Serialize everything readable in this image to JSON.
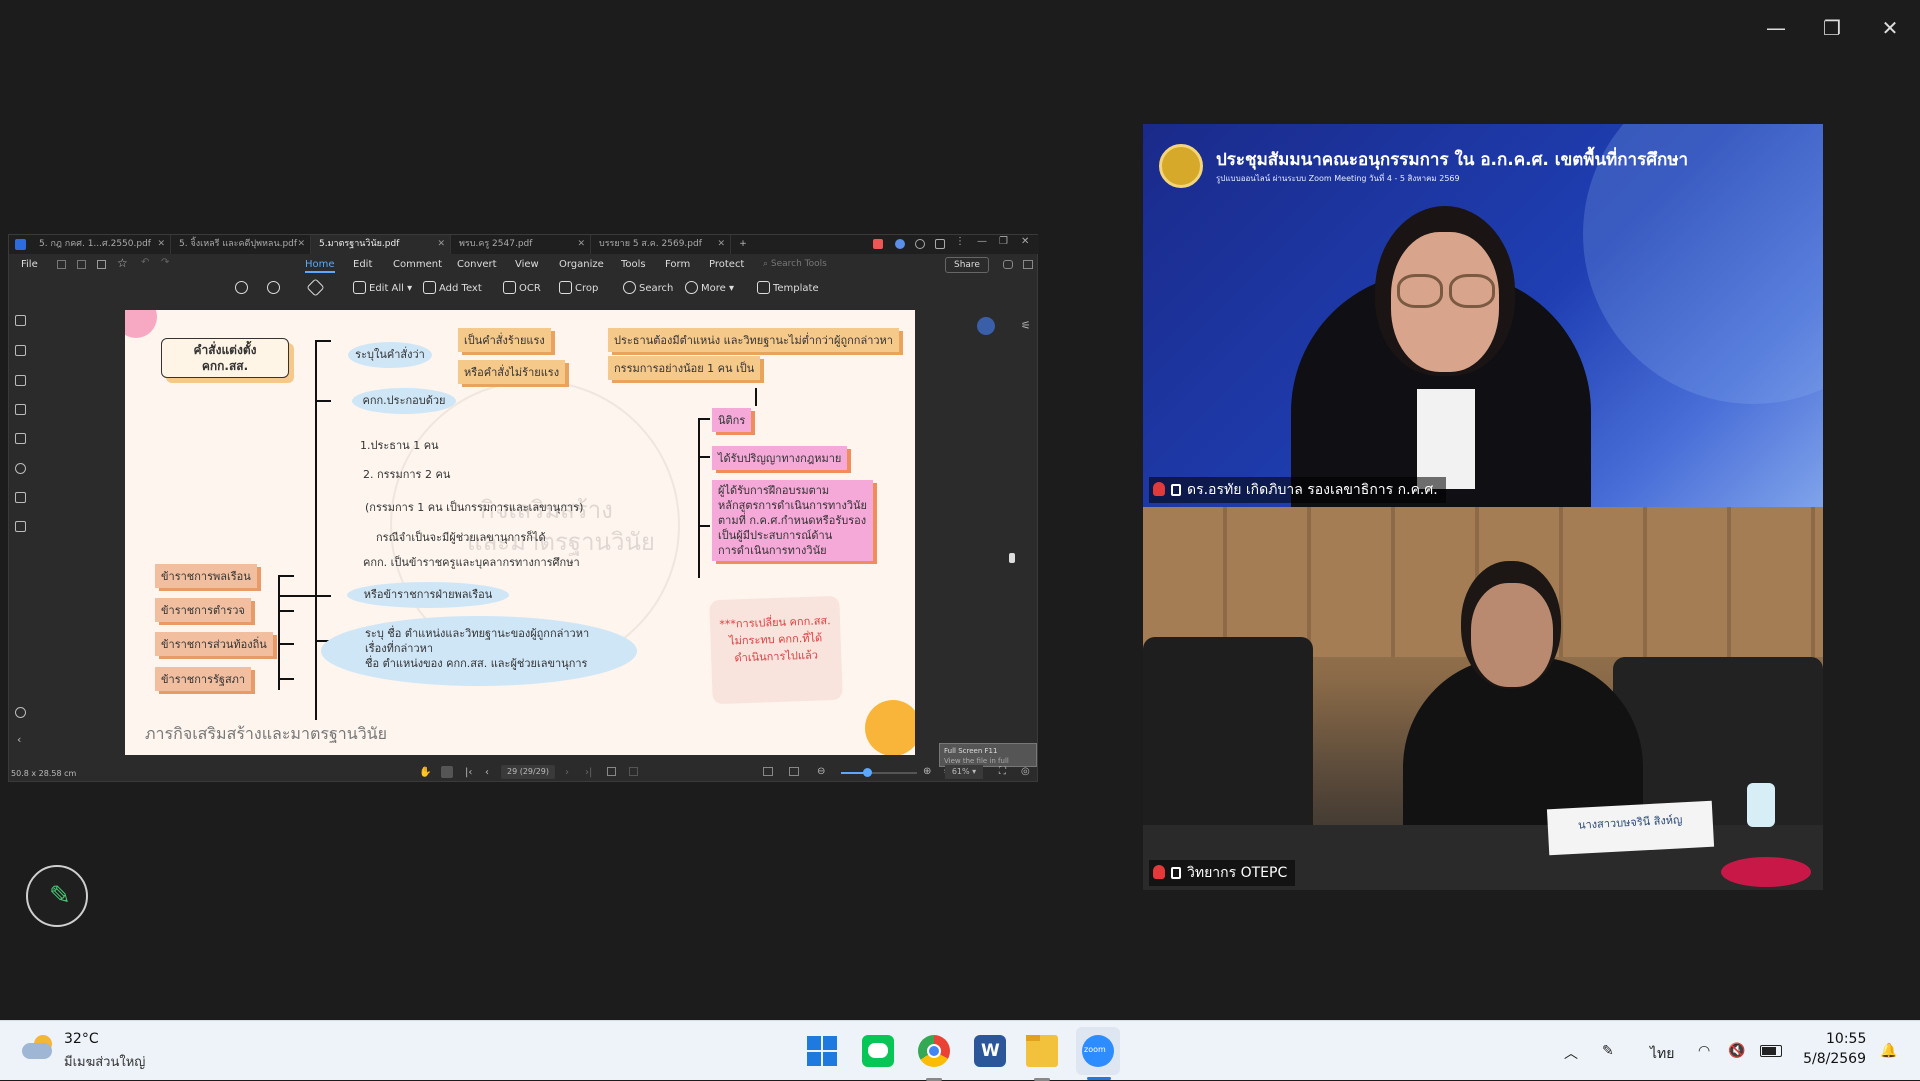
{
  "window": {
    "minimize": "—",
    "restore": "❐",
    "close": "✕"
  },
  "pdf": {
    "tabs": [
      {
        "label": "5. กฎ กคศ. 1...ศ.2550.pdf",
        "active": false
      },
      {
        "label": "5. จิ้งเหลรี และคดีปุพหลน.pdf",
        "active": false
      },
      {
        "label": "5.มาตรฐานวินัย.pdf",
        "active": true
      },
      {
        "label": "พรบ.ครู 2547.pdf",
        "active": false
      },
      {
        "label": "บรรยาย 5 ส.ค. 2569.pdf",
        "active": false
      }
    ],
    "new_tab": "+",
    "menu": {
      "file": "File",
      "home": "Home",
      "edit": "Edit",
      "comment": "Comment",
      "convert": "Convert",
      "view": "View",
      "organize": "Organize",
      "tools": "Tools",
      "form": "Form",
      "protect": "Protect",
      "search_tools": "Search Tools",
      "share": "Share"
    },
    "toolbar": {
      "edit_all": "Edit All",
      "add_text": "Add Text",
      "ocr": "OCR",
      "crop": "Crop",
      "search": "Search",
      "more": "More",
      "template": "Template"
    },
    "status": {
      "dimensions": "50.8 x 28.58 cm",
      "page": "29 (29/29)",
      "zoom": "61%"
    },
    "tooltip": {
      "title": "Full Screen   F11",
      "desc": "View the file in full screen."
    },
    "slide": {
      "title_note": "คำสั่งแต่งตั้ง\nคกก.สส.",
      "oval1": "ระบุในคำสั่งว่า",
      "note_severe": "เป็นคำสั่งร้ายแรง",
      "note_nonsevere": "หรือคำสั่งไม่ร้ายแรง",
      "note_chair": "ประธานต้องมีตำแหน่ง และวิทยฐานะไม่ต่ำกว่าผู้ถูกกล่าวหา",
      "note_members": "กรรมการอย่างน้อย 1 คน เป็น",
      "oval2": "คกก.ประกอบด้วย",
      "item1": "1.ประธาน 1 คน",
      "item2": "2. กรรมการ 2 คน",
      "item3": "(กรรมการ 1 คน เป็นกรรมการและเลขานุการ)",
      "item4": "กรณีจำเป็นจะมีผู้ช่วยเลขานุการก็ได้",
      "item5": "คกก. เป็นข้าราชครูและบุคลากรทางการศึกษา",
      "note_legal": "นิติกร",
      "note_law_degree": "ได้รับปริญญาทางกฎหมาย",
      "note_trained": "ผู้ได้รับการฝึกอบรมตาม\nหลักสูตรการดำเนินการทางวินัย\nตามที่ ก.ค.ศ.กำหนดหรือรับรอง\nเป็นผู้มีประสบการณ์ด้าน\nการดำเนินการทางวินัย",
      "watermark1": "กิจเสริมสร้าง",
      "watermark2": "และมาตรฐานวินัย",
      "left1": "ข้าราชการพลเรือน",
      "left2": "ข้าราชการตำรวจ",
      "left3": "ข้าราชการส่วนท้องถิ่น",
      "left4": "ข้าราชการรัฐสภา",
      "oval3": "หรือข้าราชการฝ่ายพลเรือน",
      "oval4": "ระบุ ชื่อ ตำแหน่งและวิทยฐานะของผู้ถูกกล่าวหา\nเรื่องที่กล่าวหา\nชื่อ ตำแหน่งของ คกก.สส. และผู้ช่วยเลขานุการ",
      "red_note": "***การเปลี่ยน คกก.สส.\nไม่กระทบ คกก.ที่ได้\nดำเนินการไปแล้ว",
      "footer": "ภารกิจเสริมสร้างและมาตรฐานวินัย"
    }
  },
  "meeting": {
    "banner_title": "ประชุมสัมมนาคณะอนุกรรมการ ใน อ.ก.ค.ศ. เขตพื้นที่การศึกษา",
    "banner_subtitle": "รูปแบบออนไลน์ ผ่านระบบ Zoom Meeting  วันที่ 4 - 5 สิงหาคม 2569",
    "participant1": "ดร.อรทัย เกิดภิบาล รองเลขาธิการ ก.ค.ศ.",
    "participant2": "วิทยากร OTEPC",
    "nameplate": "นางสาวบษจรินี  สิงห์ญ"
  },
  "taskbar": {
    "temp": "32°C",
    "weather": "มีเมฆส่วนใหญ่",
    "lang": "ไทย",
    "time": "10:55",
    "date": "5/8/2569",
    "apps": [
      "windows-start",
      "line",
      "chrome",
      "word",
      "file-explorer",
      "zoom"
    ]
  },
  "colors": {
    "accent": "#5aa8ff",
    "slide_bg": "#fdf5ee",
    "note_orange": "#f5c98a",
    "note_pink": "#f4a9d8",
    "oval_blue": "#cfe6f7",
    "zoom_blue": "#2d8cff"
  }
}
